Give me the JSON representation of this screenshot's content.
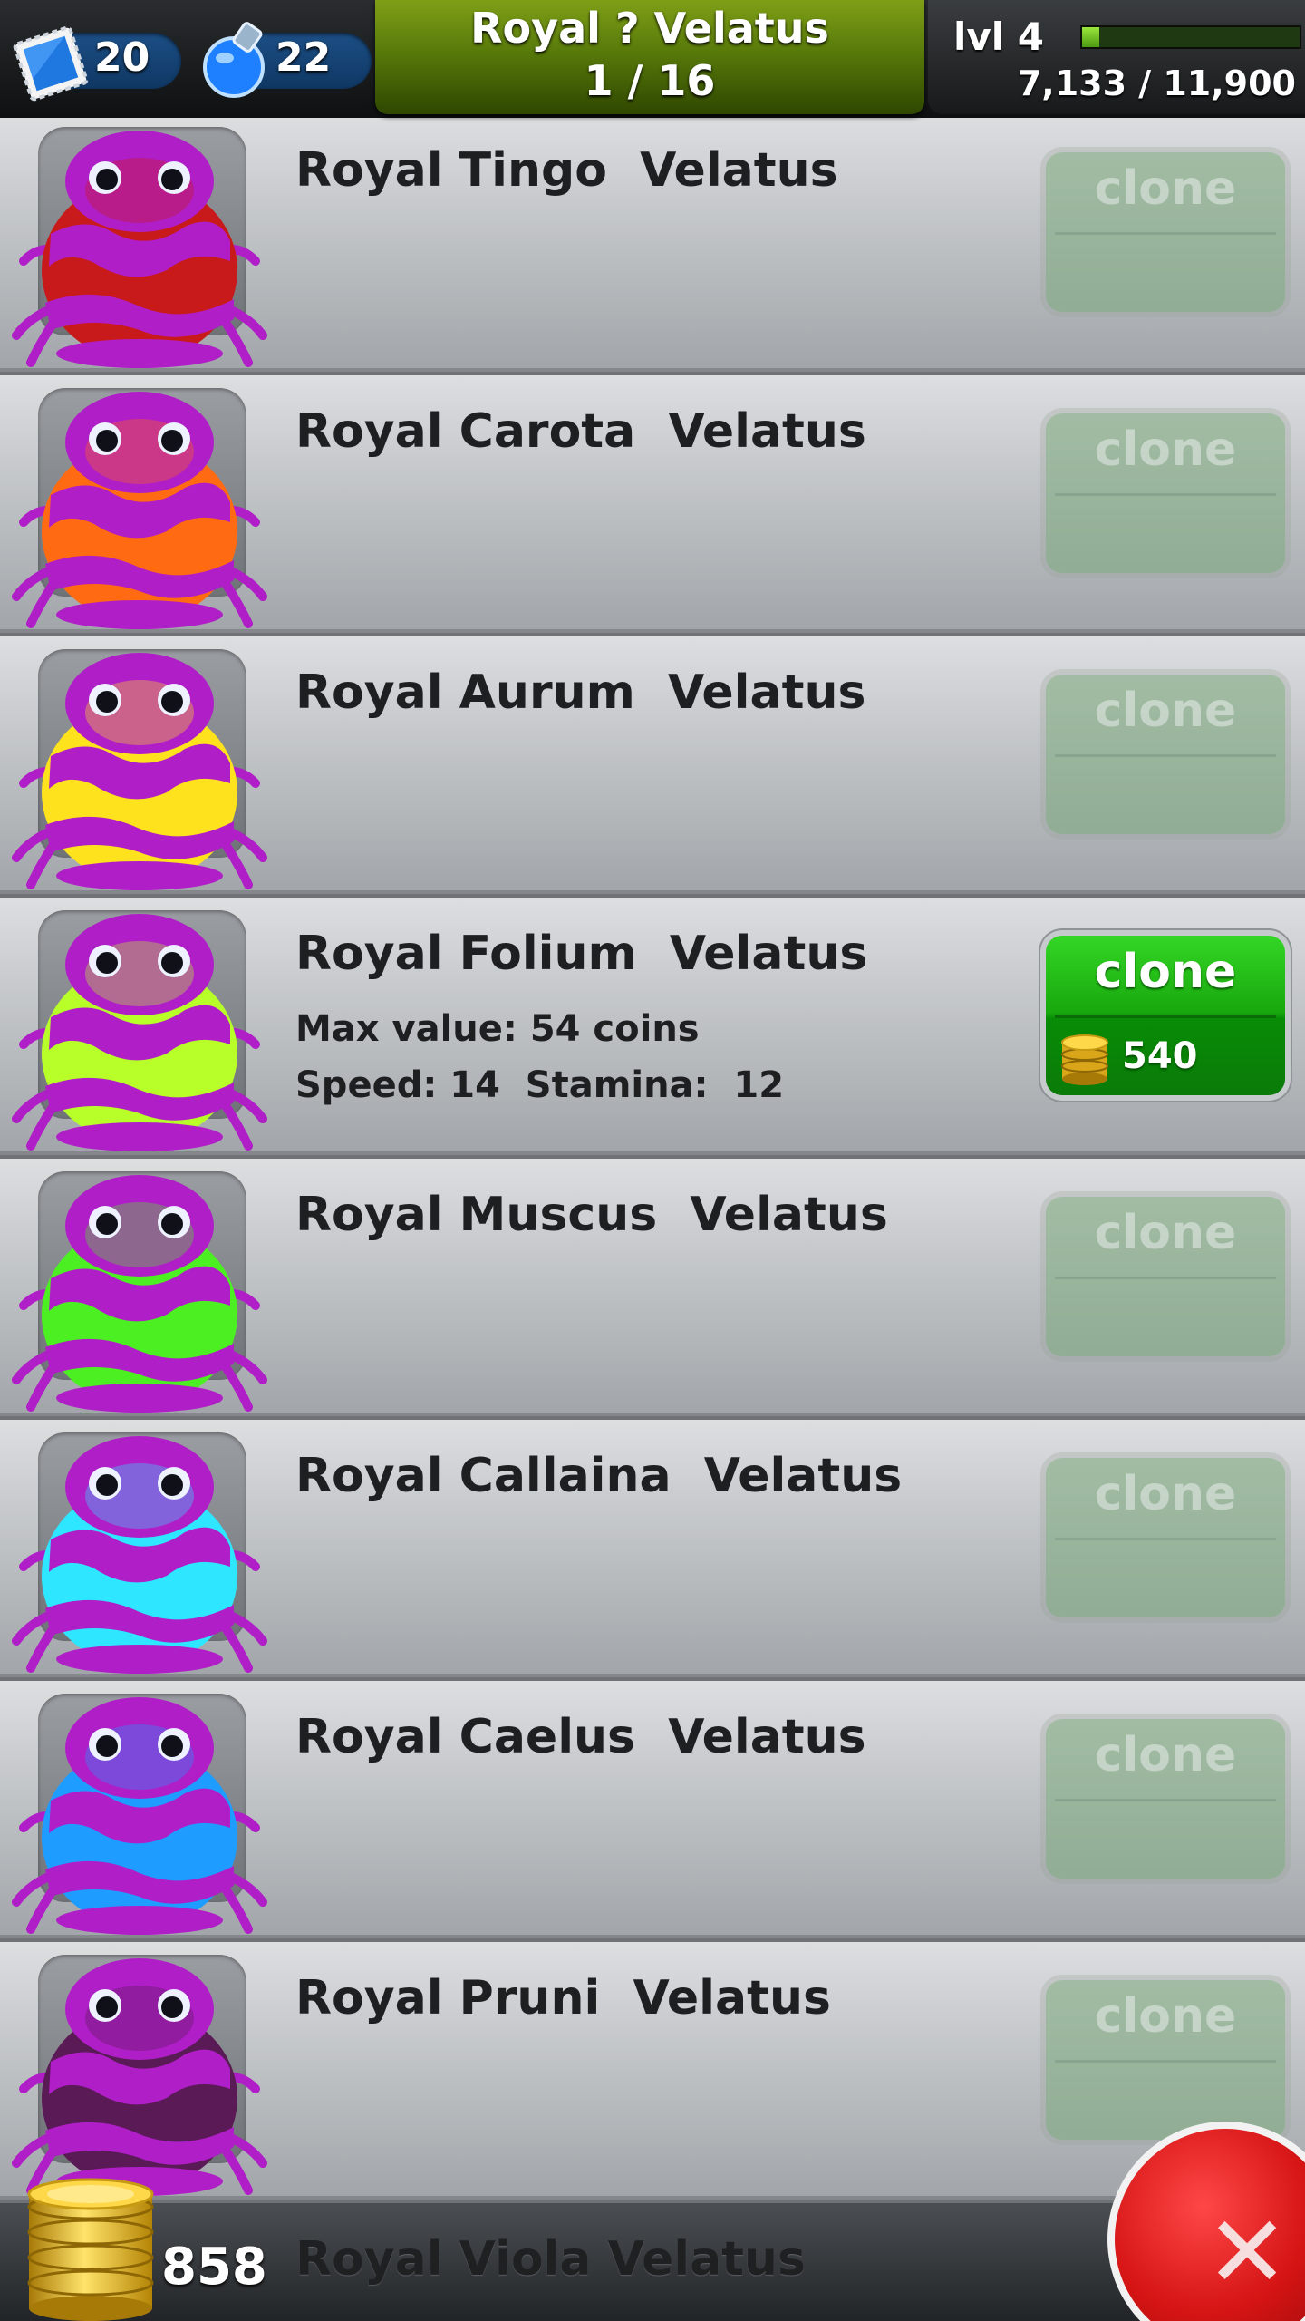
{
  "header": {
    "stamps": "20",
    "potions": "22",
    "title": "Royal ? Velatus",
    "counter": "1 / 16",
    "level": "lvl 4",
    "xp_text": "7,133 / 11,900",
    "xp_progress": 0.08
  },
  "clone_label": "clone",
  "frogs": [
    {
      "name": "Royal Tingo  Velatus",
      "color": "#c81a1a",
      "enabled": false
    },
    {
      "name": "Royal Carota  Velatus",
      "color": "#ff6a12",
      "enabled": false
    },
    {
      "name": "Royal Aurum  Velatus",
      "color": "#ffe21e",
      "enabled": false
    },
    {
      "name": "Royal Folium  Velatus",
      "color": "#b8ff2a",
      "enabled": true,
      "max_value": "Max value: 54 coins",
      "stats": "Speed: 14  Stamina:  12",
      "price": "540"
    },
    {
      "name": "Royal Muscus  Velatus",
      "color": "#4cf022",
      "enabled": false
    },
    {
      "name": "Royal Callaina  Velatus",
      "color": "#2ee6ff",
      "enabled": false
    },
    {
      "name": "Royal Caelus  Velatus",
      "color": "#1e9cff",
      "enabled": false
    },
    {
      "name": "Royal Pruni  Velatus",
      "color": "#5a1a56",
      "enabled": false
    }
  ],
  "footer": {
    "coins": "858",
    "next_frog_name": "Royal Viola  Velatus"
  },
  "icons": {
    "stamp": "stamp-icon",
    "potion": "potion-icon",
    "coin": "coin-icon",
    "close": "close-icon"
  },
  "colors": {
    "frog_spots": "#b01ec8",
    "clone_active": "#18a80d",
    "close_red": "#d51414"
  }
}
